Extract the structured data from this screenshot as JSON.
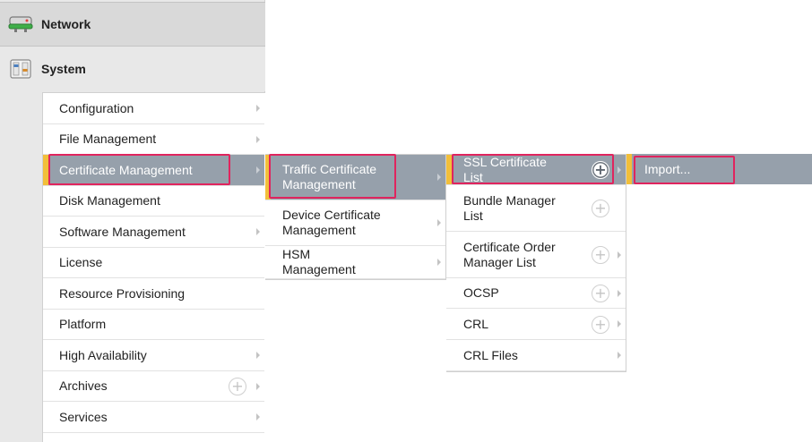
{
  "nav": {
    "network_label": "Network",
    "system_label": "System"
  },
  "menu_level1": [
    {
      "label": "Configuration",
      "arrow": true,
      "plus": false,
      "selected": false
    },
    {
      "label": "File Management",
      "arrow": true,
      "plus": false,
      "selected": false
    },
    {
      "label": "Certificate Management",
      "arrow": true,
      "plus": false,
      "selected": true
    },
    {
      "label": "Disk Management",
      "arrow": false,
      "plus": false,
      "selected": false
    },
    {
      "label": "Software Management",
      "arrow": true,
      "plus": false,
      "selected": false
    },
    {
      "label": "License",
      "arrow": false,
      "plus": false,
      "selected": false
    },
    {
      "label": "Resource Provisioning",
      "arrow": false,
      "plus": false,
      "selected": false
    },
    {
      "label": "Platform",
      "arrow": false,
      "plus": false,
      "selected": false
    },
    {
      "label": "High Availability",
      "arrow": true,
      "plus": false,
      "selected": false
    },
    {
      "label": "Archives",
      "arrow": true,
      "plus": true,
      "selected": false
    },
    {
      "label": "Services",
      "arrow": true,
      "plus": false,
      "selected": false
    }
  ],
  "menu_level2": [
    {
      "label": "Traffic Certificate Management",
      "arrow": true,
      "selected": true
    },
    {
      "label": "Device Certificate Management",
      "arrow": true,
      "selected": false
    },
    {
      "label": "HSM Management",
      "arrow": true,
      "selected": false
    }
  ],
  "menu_level3": [
    {
      "label": "SSL Certificate List",
      "arrow": true,
      "plus": true,
      "selected": true
    },
    {
      "label": "Bundle Manager List",
      "arrow": false,
      "plus": true,
      "selected": false
    },
    {
      "label": "Certificate Order Manager List",
      "arrow": true,
      "plus": true,
      "selected": false
    },
    {
      "label": "OCSP",
      "arrow": true,
      "plus": true,
      "selected": false
    },
    {
      "label": "CRL",
      "arrow": true,
      "plus": true,
      "selected": false
    },
    {
      "label": "CRL Files",
      "arrow": true,
      "plus": false,
      "selected": false
    }
  ],
  "menu_level4": [
    {
      "label": "Import...",
      "selected": true
    }
  ],
  "colors": {
    "selected_bg": "#96a0ab",
    "selected_marker": "#f2bf3a",
    "highlight_box": "#e0245e",
    "network_icon_accent": "#3fae49"
  },
  "icons": {
    "network": "network-icon",
    "system": "system-icon",
    "submenu": "chevron-right-icon",
    "create": "plus-circle-icon"
  }
}
